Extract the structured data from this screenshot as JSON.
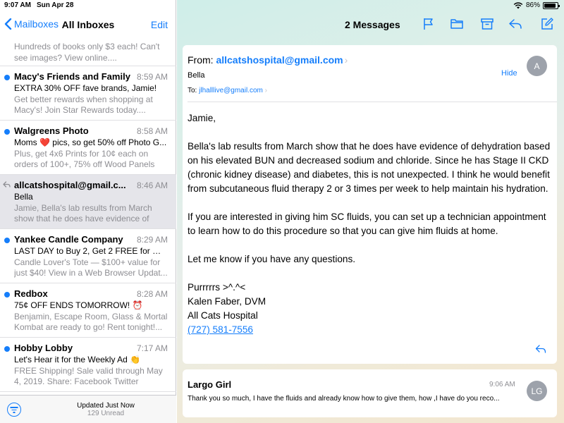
{
  "status_bar": {
    "time": "9:07 AM",
    "date": "Sun Apr 28",
    "battery": "86%"
  },
  "sidebar": {
    "back_label": "Mailboxes",
    "title": "All Inboxes",
    "edit_label": "Edit",
    "partial_preview": "Hundreds of books only $3 each! Can't see images? View online....",
    "messages": [
      {
        "sender": "Macy's Friends and Family",
        "time": "8:59 AM",
        "subject": "EXTRA 30% OFF fave brands, Jamie!",
        "preview": "Get better rewards when shopping at Macy's! Join Star Rewards today....",
        "unread": true
      },
      {
        "sender": "Walgreens Photo",
        "time": "8:58 AM",
        "subject": "Moms ❤️ pics, so get 50% off Photo G...",
        "preview": "Plus, get 4x6 Prints for 10¢ each on orders of 100+, 75% off Wood Panels a...",
        "unread": true
      },
      {
        "sender": "allcatshospital@gmail.c...",
        "time": "8:46 AM",
        "subject": "Bella",
        "preview": "Jamie, Bella's lab results from March show that he does have evidence of de...",
        "unread": false,
        "replied": true,
        "selected": true
      },
      {
        "sender": "Yankee Candle Company",
        "time": "8:29 AM",
        "subject": "LAST DAY to Buy 2, Get 2 FREE for Mo...",
        "preview": "Candle Lover's Tote — $100+ value for just $40! View in a Web Browser Updat...",
        "unread": true
      },
      {
        "sender": "Redbox",
        "time": "8:28 AM",
        "subject": "75¢ OFF ENDS TOMORROW! ⏰",
        "preview": "Benjamin, Escape Room, Glass & Mortal Kombat are ready to go! Rent tonight!...",
        "unread": true
      },
      {
        "sender": "Hobby Lobby",
        "time": "7:17 AM",
        "subject": "Let's Hear it for the Weekly Ad 👏",
        "preview": "FREE Shipping! Sale valid through May 4, 2019. Share: Facebook Twitter Email...",
        "unread": true
      }
    ],
    "footer": {
      "status": "Updated Just Now",
      "unread": "129 Unread"
    }
  },
  "thread": {
    "title": "2 Messages",
    "message": {
      "from_label": "From:",
      "from": "allcatshospital@gmail.com",
      "subject": "Bella",
      "to_label": "To:",
      "to": "jlhalllive@gmail.com",
      "hide_label": "Hide",
      "avatar": "A",
      "greeting": "Jamie,",
      "paragraphs": [
        "Bella's lab results from March show that he does have evidence of dehydration based on his elevated BUN and decreased sodium and chloride. Since he has Stage II CKD (chronic kidney disease) and diabetes, this is not unexpected. I think he would benefit from subcutaneous fluid therapy 2 or 3 times per week to help maintain his hydration.",
        "If you are interested in giving him SC fluids, you can set up a technician appointment to learn how to do this procedure so that you can give him fluids at home.",
        "Let me know if you have any questions."
      ],
      "signature": [
        "Purrrrrs >^.^<",
        "Kalen Faber, DVM",
        "All Cats Hospital"
      ],
      "phone": "(727) 581-7556"
    },
    "reply": {
      "sender": "Largo Girl",
      "time": "9:06 AM",
      "preview": "Thank you so much, I have the fluids and already know how to give them, how ,I have do you reco...",
      "avatar": "LG"
    }
  },
  "colors": {
    "accent": "#157efb",
    "secondary_text": "#8e8e93",
    "avatar": "#9da2ab"
  }
}
